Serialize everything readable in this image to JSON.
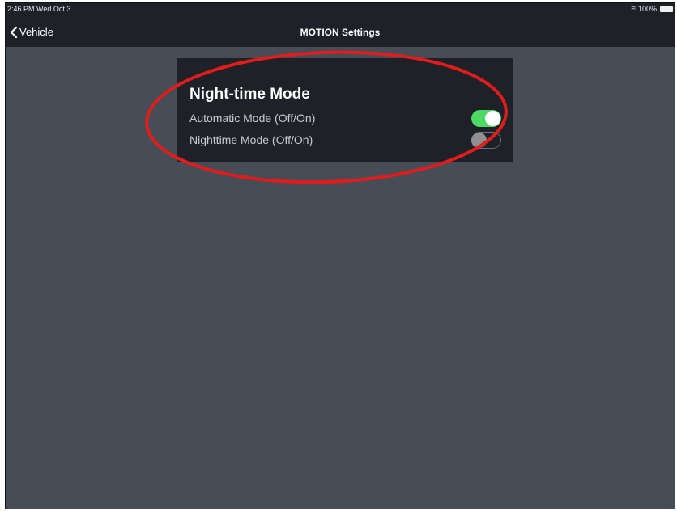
{
  "status_bar": {
    "time": "2:46 PM  Wed Oct 3",
    "signal": "....",
    "battery": "100%",
    "wifi_icon": "wifi-icon",
    "battery_icon": "battery-icon"
  },
  "nav_bar": {
    "back_label": "Vehicle",
    "back_icon": "chevron-left-icon",
    "title": "MOTION Settings"
  },
  "night_mode_card": {
    "title": "Night-time Mode",
    "settings": [
      {
        "label": "Automatic Mode (Off/On)",
        "enabled": true
      },
      {
        "label": "Nighttime Mode (Off/On)",
        "enabled": false
      }
    ]
  },
  "colors": {
    "background": "#474d57",
    "panel": "#1e2127",
    "toggle_on": "#4cd964",
    "toggle_off_knob": "#8e8e93",
    "annotation": "#e31b1b"
  }
}
